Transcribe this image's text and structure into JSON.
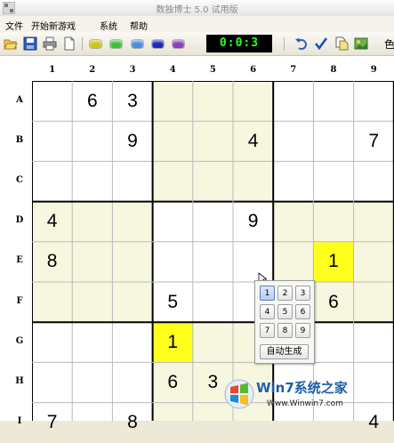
{
  "window": {
    "title": "数独博士 5.0 试用版"
  },
  "menu": [
    "文件",
    "开始新游戏",
    "系统",
    "帮助"
  ],
  "toolbar": {
    "timer": "0:0:3",
    "right_label": "色",
    "color_dots": [
      "#c9c918",
      "#3fbf3f",
      "#4a8fd8",
      "#1a2bb8",
      "#8a3fb8"
    ]
  },
  "board": {
    "col_labels": [
      "1",
      "2",
      "3",
      "4",
      "5",
      "6",
      "7",
      "8",
      "9"
    ],
    "row_labels": [
      "A",
      "B",
      "C",
      "D",
      "E",
      "F",
      "G",
      "H",
      "I"
    ],
    "box_shade": "#f7f7e0",
    "highlight": "#ffff1e",
    "cells": [
      {
        "r": 0,
        "c": 1,
        "v": "6"
      },
      {
        "r": 0,
        "c": 2,
        "v": "3"
      },
      {
        "r": 1,
        "c": 2,
        "v": "9"
      },
      {
        "r": 1,
        "c": 5,
        "v": "4"
      },
      {
        "r": 1,
        "c": 8,
        "v": "7"
      },
      {
        "r": 3,
        "c": 0,
        "v": "4"
      },
      {
        "r": 3,
        "c": 5,
        "v": "9"
      },
      {
        "r": 4,
        "c": 0,
        "v": "8"
      },
      {
        "r": 4,
        "c": 7,
        "v": "1",
        "hl": true
      },
      {
        "r": 5,
        "c": 3,
        "v": "5"
      },
      {
        "r": 5,
        "c": 7,
        "v": "6"
      },
      {
        "r": 6,
        "c": 3,
        "v": "1",
        "hl": true
      },
      {
        "r": 7,
        "c": 3,
        "v": "6"
      },
      {
        "r": 7,
        "c": 4,
        "v": "3"
      },
      {
        "r": 8,
        "c": 0,
        "v": "7"
      },
      {
        "r": 8,
        "c": 2,
        "v": "8"
      },
      {
        "r": 8,
        "c": 8,
        "v": "4"
      }
    ]
  },
  "number_pad": {
    "buttons": [
      "1",
      "2",
      "3",
      "4",
      "5",
      "6",
      "7",
      "8",
      "9"
    ],
    "selected": "1",
    "auto_label": "自动生成"
  },
  "watermark": {
    "main": "Win7系统之家",
    "sub": "Www.Winwin7.com"
  }
}
